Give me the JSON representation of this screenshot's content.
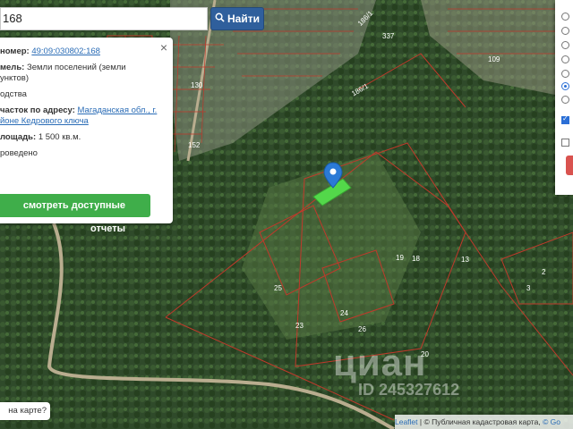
{
  "search": {
    "value": "168"
  },
  "find_button": {
    "label": "Найти"
  },
  "info": {
    "cadastral_label": "номер:",
    "cadastral_value": "49:09:030802:168",
    "category_label": "мель:",
    "category_value": "Земли поселений (земли",
    "category_value2": "унктов)",
    "use_value": "одства",
    "address_label": "часток по адресу:",
    "address_value": "Магаданская обл., г.",
    "address_value2": "йоне Кедрового ключа",
    "area_label": "лощадь:",
    "area_value": "1 500 кв.м.",
    "status_value": "роведено",
    "reports_button": "смотреть доступные отчеты"
  },
  "map_question": "на карте?",
  "attribution": {
    "leaflet": "Leaflet",
    "sep": "|",
    "copy": "© Публичная кадастровая карта,",
    "google": "© Go"
  },
  "watermark": {
    "brand": "циан",
    "id": "ID 245327612"
  },
  "plot_labels": [
    {
      "t": "186/1"
    },
    {
      "t": "186/1"
    },
    {
      "t": "337"
    },
    {
      "t": "109"
    },
    {
      "t": "130"
    },
    {
      "t": "152"
    },
    {
      "t": "18"
    },
    {
      "t": "19"
    },
    {
      "t": "13"
    },
    {
      "t": "20"
    },
    {
      "t": "25"
    },
    {
      "t": "26"
    },
    {
      "t": "23"
    },
    {
      "t": "24"
    },
    {
      "t": "2"
    },
    {
      "t": "3"
    }
  ],
  "colors": {
    "accent": "#2f5f9c",
    "green_btn": "#3fae4a",
    "red_line": "#c0392b"
  }
}
